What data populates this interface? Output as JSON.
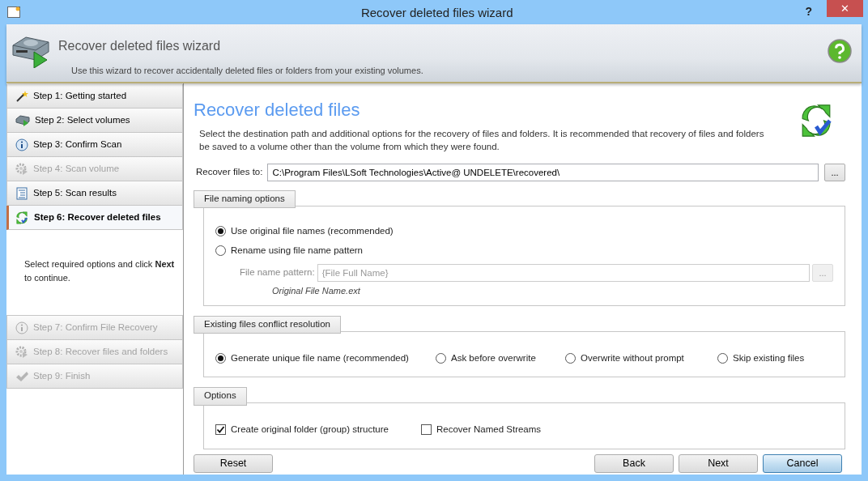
{
  "window": {
    "title": "Recover deleted files wizard",
    "help_glyph": "?",
    "close_glyph": "✕"
  },
  "header": {
    "title": "Recover deleted files wizard",
    "subtitle": "Use this wizard to recover accidentally deleted files or folders from your existing volumes."
  },
  "sidebar": {
    "steps": [
      {
        "label": "Step 1: Getting started",
        "selected": false,
        "disabled": false
      },
      {
        "label": "Step 2: Select volumes",
        "selected": false,
        "disabled": false
      },
      {
        "label": "Step 3: Confirm Scan",
        "selected": false,
        "disabled": false
      },
      {
        "label": "Step 4: Scan volume",
        "selected": false,
        "disabled": true
      },
      {
        "label": "Step 5: Scan results",
        "selected": false,
        "disabled": false
      },
      {
        "label": "Step 6: Recover deleted files",
        "selected": true,
        "disabled": false
      }
    ],
    "hint": "Select required options and click **Next** to continue.",
    "later_steps": [
      {
        "label": "Step 7: Confirm File Recovery",
        "selected": false,
        "disabled": true
      },
      {
        "label": "Step 8: Recover files and folders",
        "selected": false,
        "disabled": true
      },
      {
        "label": "Step 9: Finish",
        "selected": false,
        "disabled": true
      }
    ]
  },
  "content": {
    "heading": "Recover deleted files",
    "description": "Select the destination path and additional options for the recovery of files and folders. It is recommended that recovery of files and folders be saved to a volume other than the volume from which they were found.",
    "destination": {
      "label": "Recover files to:",
      "value": "C:\\Program Files\\LSoft Technologies\\Active@ UNDELETE\\recovered\\",
      "browse_button": "..."
    },
    "file_naming": {
      "title": "File naming options",
      "options": [
        {
          "label": "Use original file names (recommended)",
          "selected": true
        },
        {
          "label": "Rename using file name pattern",
          "selected": false
        }
      ],
      "pattern": {
        "label": "File name pattern:",
        "value": "{File Full Name}",
        "browse_button": "...",
        "example": "Original File Name.ext",
        "disabled": true
      }
    },
    "conflict": {
      "title": "Existing files conflict resolution",
      "options": [
        {
          "label": "Generate unique file name (recommended)",
          "selected": true
        },
        {
          "label": "Ask before overwrite",
          "selected": false
        },
        {
          "label": "Overwrite without prompt",
          "selected": false
        },
        {
          "label": "Skip existing files",
          "selected": false
        }
      ]
    },
    "options": {
      "title": "Options",
      "checkboxes": [
        {
          "label": "Create original folder (group) structure",
          "checked": true
        },
        {
          "label": "Recover Named Streams",
          "checked": false
        }
      ]
    }
  },
  "buttons": [
    {
      "label": "Reset",
      "default": false
    },
    {
      "label": "Back",
      "default": false
    },
    {
      "label": "Next",
      "default": false
    },
    {
      "label": "Cancel",
      "default": true
    }
  ]
}
